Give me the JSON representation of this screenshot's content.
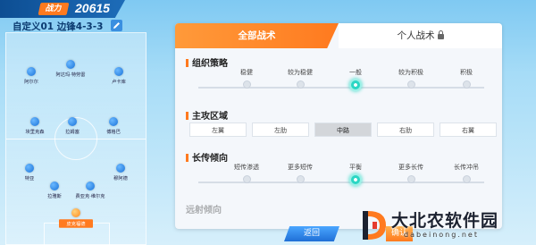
{
  "header": {
    "power_label": "战力",
    "power_value": "20615",
    "formation_name": "自定义01 边锋4-3-3"
  },
  "pitch": {
    "players": [
      {
        "name": "阿尔尔"
      },
      {
        "name": "阿达玛·特劳雷"
      },
      {
        "name": "卢卡库"
      },
      {
        "name": "埃里克森"
      },
      {
        "name": "拉姆塞"
      },
      {
        "name": "博格巴"
      },
      {
        "name": "特亚"
      },
      {
        "name": "穆阿德"
      },
      {
        "name": "拉雅斯"
      },
      {
        "name": "费亚克·维尔克"
      },
      {
        "name": "皮克福德"
      }
    ]
  },
  "tabs": [
    {
      "label": "全部战术",
      "active": true
    },
    {
      "label": "个人战术",
      "active": false,
      "locked": true
    }
  ],
  "sections": {
    "organization": {
      "title": "组织策略",
      "options": [
        "稳健",
        "较为稳健",
        "一般",
        "较为积极",
        "积极"
      ],
      "selected": "一般"
    },
    "attack_area": {
      "title": "主攻区域",
      "options": [
        "左翼",
        "左肋",
        "中路",
        "右肋",
        "右翼"
      ],
      "selected": "中路"
    },
    "long_pass": {
      "title": "长传倾向",
      "options": [
        "短传渗透",
        "更多短传",
        "平衡",
        "更多长传",
        "长传冲吊"
      ],
      "selected": "平衡"
    },
    "next_section_title": "远射倾向"
  },
  "buttons": {
    "back": "返回",
    "confirm": "确认"
  },
  "watermark": {
    "title": "大北农软件园",
    "url": "dabeinong.net"
  },
  "colors": {
    "accent": "#ff7a1f",
    "selected_node": "#2bd6c4",
    "player_dot": "#1a73d9"
  }
}
